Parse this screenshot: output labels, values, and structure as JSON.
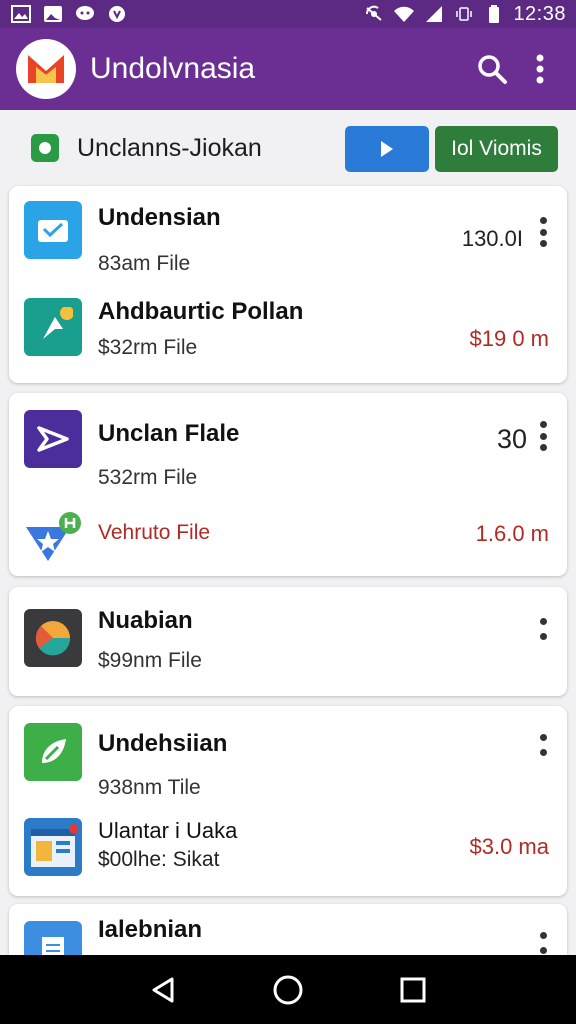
{
  "status_bar": {
    "time": "12:38",
    "left_icons": [
      "gallery-icon",
      "image-icon",
      "chat-icon",
      "shield-icon"
    ],
    "right_icons": [
      "nfc-icon",
      "wifi-icon",
      "signal-icon",
      "vibrate-icon",
      "battery-icon"
    ]
  },
  "app_bar": {
    "title": "Undolvnasia",
    "actions": [
      "search-icon",
      "more-vert-icon"
    ],
    "colors": {
      "status": "#5c2a82",
      "appbar": "#6b2f94"
    }
  },
  "toolbar": {
    "label": "Unclanns-Jiokan",
    "play_button": "play-icon",
    "view_button": "Iol Viomis",
    "colors": {
      "play": "#2a7ad8",
      "view": "#2f7d3b",
      "check": "#2b9a45"
    }
  },
  "cards": [
    {
      "rows": [
        {
          "icon": "inbox-icon",
          "title": "Undensian",
          "sub": "83am File",
          "right": "130.0I",
          "menu": true
        },
        {
          "icon": "arrow-app-icon",
          "title": "Ahdbaurtic Pollan",
          "sub": "$32rm File",
          "right": "$19 0 m"
        }
      ]
    },
    {
      "rows": [
        {
          "icon": "send-app-icon",
          "title": "Unclan Flale",
          "sub": "532rm File",
          "right": "30",
          "menu": true
        },
        {
          "icon": "star-shield-icon",
          "title": "",
          "sub": "Vehruto File",
          "right": "1.6.0 m"
        }
      ]
    },
    {
      "rows": [
        {
          "icon": "radar-app-icon",
          "title": "Nuabian",
          "sub": "$99nm File",
          "right": "",
          "menu": true
        }
      ]
    },
    {
      "rows": [
        {
          "icon": "leaf-app-icon",
          "title": "Undehsiian",
          "sub": "938nm Tile",
          "right": "",
          "menu": true
        },
        {
          "icon": "browser-app-icon",
          "title": "Ulantar i Uaka",
          "sub": "$00lhe: Sikat",
          "right": "$3.0 ma"
        }
      ]
    },
    {
      "rows": [
        {
          "icon": "document-app-icon",
          "title": "Ialebnian",
          "sub": "",
          "right": "",
          "menu": true
        }
      ]
    }
  ],
  "nav_bar": [
    "back-icon",
    "home-icon",
    "recents-icon"
  ]
}
